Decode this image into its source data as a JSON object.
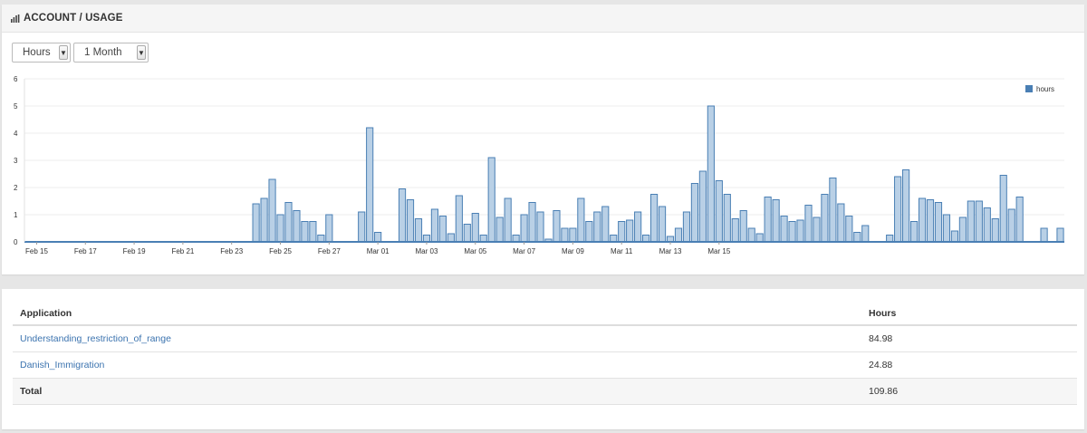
{
  "header": {
    "title": "ACCOUNT / USAGE",
    "icon": "bar-chart-icon"
  },
  "controls": {
    "metric": {
      "selected": "Hours"
    },
    "period": {
      "selected": "1 Month"
    }
  },
  "chart_data": {
    "type": "bar",
    "series": [
      {
        "name": "hours",
        "color": "#4a7fb4",
        "fill": "#b9d0e6",
        "values": [
          0,
          0,
          0,
          0,
          0,
          0,
          0,
          0,
          0,
          0,
          0,
          0,
          0,
          0,
          0,
          0,
          0,
          0,
          0,
          0,
          0,
          0,
          0,
          0,
          0,
          0,
          0,
          0,
          1.4,
          1.6,
          2.3,
          1.0,
          1.45,
          1.15,
          0.75,
          0.75,
          0.25,
          1.0,
          0,
          0,
          0,
          1.1,
          4.2,
          0.35,
          0,
          0,
          1.95,
          1.55,
          0.85,
          0.25,
          1.2,
          0.95,
          0.3,
          1.7,
          0.65,
          1.05,
          0.25,
          3.1,
          0.9,
          1.6,
          0.25,
          1.0,
          1.45,
          1.1,
          0.1,
          1.15,
          0.5,
          0.5,
          1.6,
          0.75,
          1.1,
          1.3,
          0.25,
          0.75,
          0.8,
          1.1,
          0.25,
          1.75,
          1.3,
          0.2,
          0.5,
          1.1,
          2.15,
          2.6,
          5.0,
          2.25,
          1.75,
          0.85,
          1.15,
          0.5,
          0.3,
          1.65,
          1.55,
          0.95,
          0.75,
          0.8,
          1.35,
          0.9,
          1.75,
          2.35,
          1.4,
          0.95,
          0.35,
          0.6,
          0,
          0,
          0.25,
          2.4,
          2.65,
          0.75,
          1.6,
          1.55,
          1.45,
          1.0,
          0.4,
          0.9,
          1.5,
          1.5,
          1.25,
          0.85,
          2.45,
          1.2,
          1.65,
          0,
          0,
          0.5,
          0,
          0.5
        ]
      }
    ],
    "x_ticks": [
      "Feb 15",
      "Feb 17",
      "Feb 19",
      "Feb 21",
      "Feb 23",
      "Feb 25",
      "Feb 27",
      "Mar 01",
      "Mar 03",
      "Mar 05",
      "Mar 07",
      "Mar 09",
      "Mar 11",
      "Mar 13",
      "Mar 15"
    ],
    "y_ticks": [
      "0",
      "1",
      "2",
      "3",
      "4",
      "5",
      "6"
    ],
    "ylim": [
      0,
      6
    ],
    "legend": {
      "position": "top-right",
      "label": "hours"
    },
    "grid": true
  },
  "table": {
    "headers": {
      "application": "Application",
      "hours": "Hours"
    },
    "rows": [
      {
        "application": "Understanding_restriction_of_range",
        "hours": "84.98"
      },
      {
        "application": "Danish_Immigration",
        "hours": "24.88"
      }
    ],
    "total": {
      "label": "Total",
      "hours": "109.86"
    }
  }
}
